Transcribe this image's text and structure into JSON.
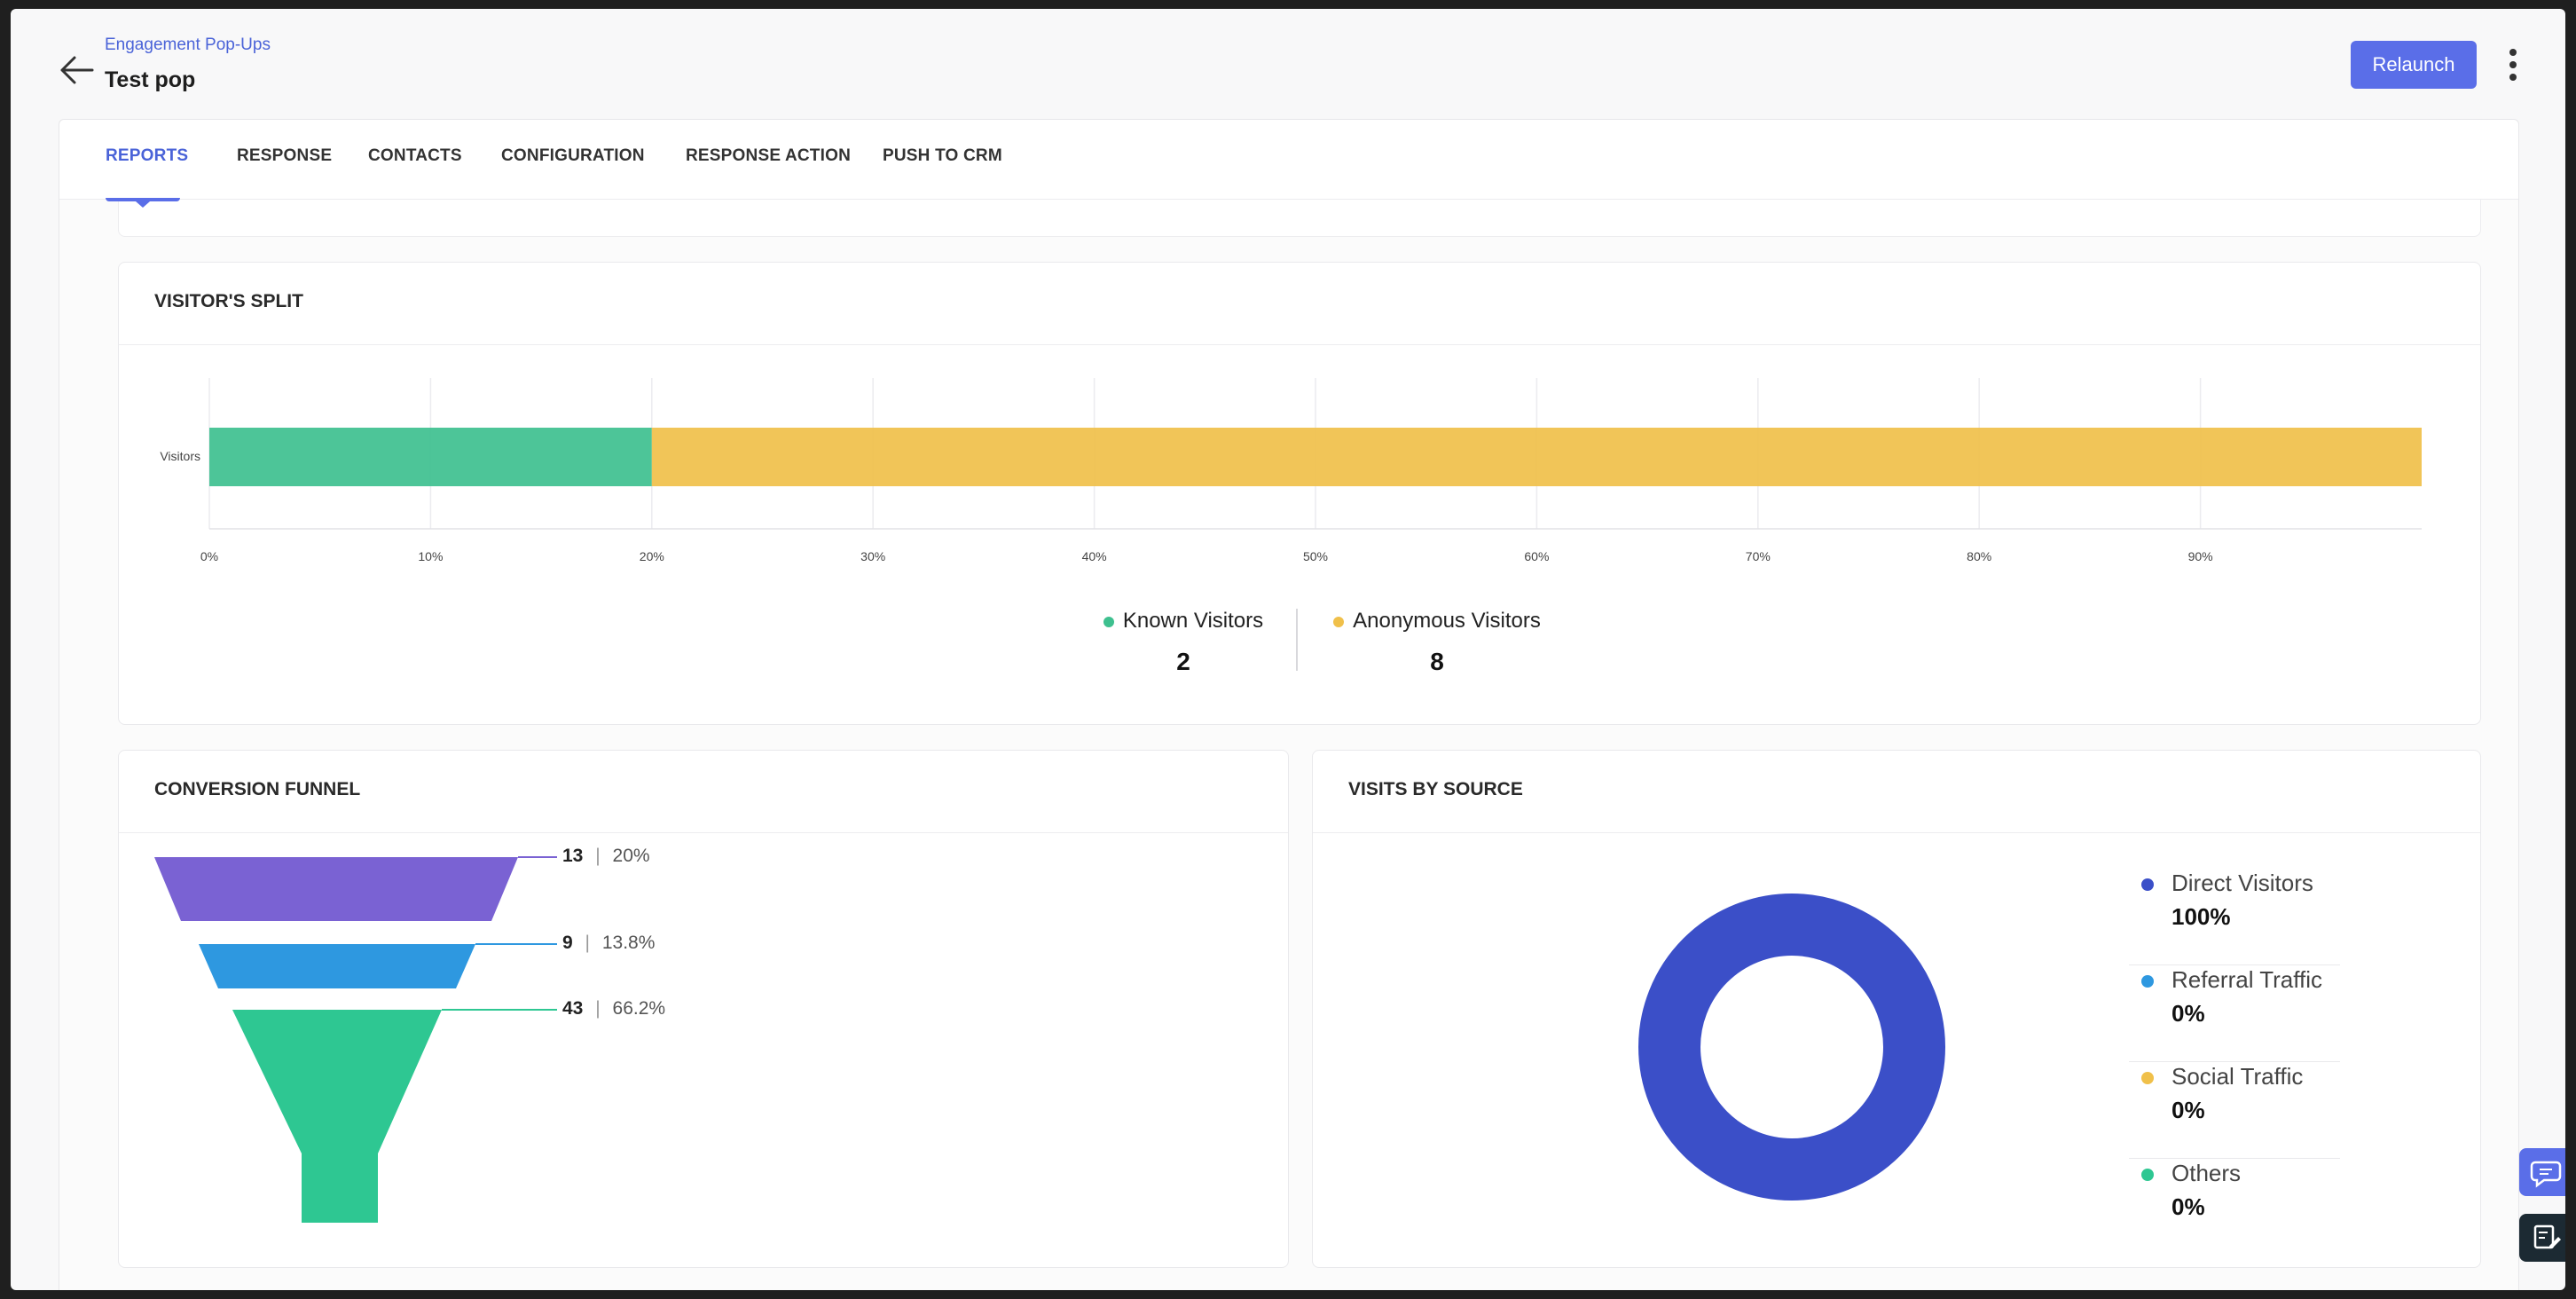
{
  "header": {
    "breadcrumb": "Engagement Pop-Ups",
    "title": "Test pop",
    "relaunch_label": "Relaunch"
  },
  "tabs": [
    {
      "label": "REPORTS",
      "active": true
    },
    {
      "label": "RESPONSE",
      "active": false
    },
    {
      "label": "CONTACTS",
      "active": false
    },
    {
      "label": "CONFIGURATION",
      "active": false
    },
    {
      "label": "RESPONSE ACTION",
      "active": false
    },
    {
      "label": "PUSH TO CRM",
      "active": false
    }
  ],
  "visitors_split": {
    "title": "VISITOR'S SPLIT",
    "legend": [
      {
        "label": "Known Visitors",
        "count": "2",
        "color": "#3ec08f"
      },
      {
        "label": "Anonymous Visitors",
        "count": "8",
        "color": "#f0c04a"
      }
    ]
  },
  "conversion_funnel": {
    "title": "CONVERSION FUNNEL",
    "stages": [
      {
        "count": "13",
        "percent": "20%",
        "color": "#7a62d3"
      },
      {
        "count": "9",
        "percent": "13.8%",
        "color": "#2e98e0"
      },
      {
        "count": "43",
        "percent": "66.2%",
        "color": "#2ec792"
      }
    ]
  },
  "visits_by_source": {
    "title": "VISITS BY SOURCE",
    "items": [
      {
        "label": "Direct Visitors",
        "value": "100%",
        "color": "#3b4fc8"
      },
      {
        "label": "Referral Traffic",
        "value": "0%",
        "color": "#2e98e0"
      },
      {
        "label": "Social Traffic",
        "value": "0%",
        "color": "#f0c04a"
      },
      {
        "label": "Others",
        "value": "0%",
        "color": "#2ec792"
      }
    ]
  },
  "chart_data": [
    {
      "type": "bar",
      "orientation": "horizontal",
      "stacked": true,
      "categories": [
        "Visitors"
      ],
      "series": [
        {
          "name": "Known Visitors",
          "values": [
            20
          ],
          "color": "#3ec08f"
        },
        {
          "name": "Anonymous Visitors",
          "values": [
            80
          ],
          "color": "#f0c04a"
        }
      ],
      "x_ticks": [
        "0%",
        "10%",
        "20%",
        "30%",
        "40%",
        "50%",
        "60%",
        "70%",
        "80%",
        "90%"
      ],
      "xlim": [
        0,
        100
      ],
      "grid": true
    },
    {
      "type": "pie",
      "donut": true,
      "categories": [
        "Direct Visitors",
        "Referral Traffic",
        "Social Traffic",
        "Others"
      ],
      "values": [
        100,
        0,
        0,
        0
      ],
      "colors": [
        "#3b4fc8",
        "#2e98e0",
        "#f0c04a",
        "#2ec792"
      ]
    }
  ]
}
